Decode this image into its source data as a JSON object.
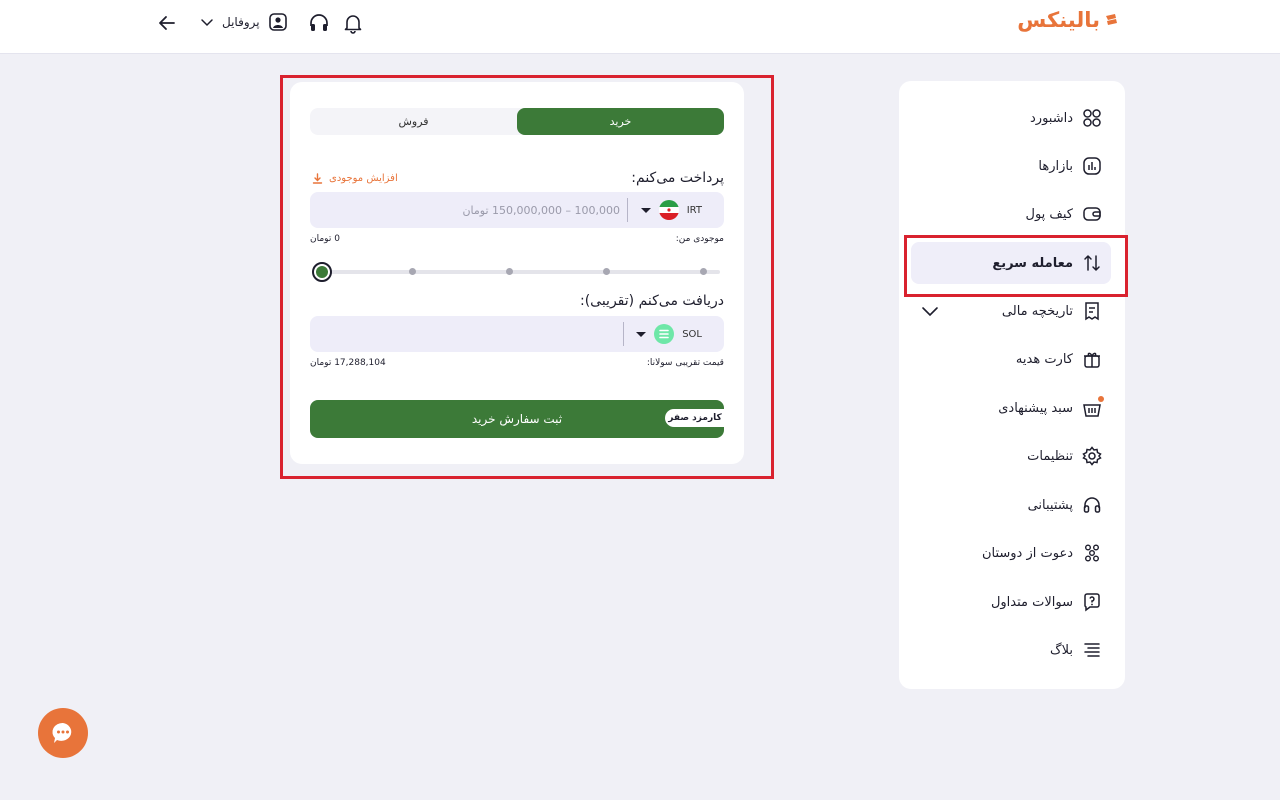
{
  "header": {
    "logo_text": "بالینکس",
    "profile_label": "پروفایل"
  },
  "sidebar": {
    "items": [
      {
        "label": "داشبورد",
        "icon": "grid-icon"
      },
      {
        "label": "بازارها",
        "icon": "markets-icon"
      },
      {
        "label": "کیف پول",
        "icon": "wallet-icon"
      },
      {
        "label": "معامله سریع",
        "icon": "swap-icon",
        "active": true
      },
      {
        "label": "تاریخچه مالی",
        "icon": "receipt-icon",
        "expandable": true
      },
      {
        "label": "کارت هدیه",
        "icon": "gift-icon"
      },
      {
        "label": "سبد پیشنهادی",
        "icon": "basket-icon",
        "badge": true
      },
      {
        "label": "تنظیمات",
        "icon": "gear-icon"
      },
      {
        "label": "پشتیبانی",
        "icon": "headset-icon"
      },
      {
        "label": "دعوت از دوستان",
        "icon": "invite-icon"
      },
      {
        "label": "سوالات متداول",
        "icon": "question-icon"
      },
      {
        "label": "بلاگ",
        "icon": "blog-icon"
      }
    ]
  },
  "trade": {
    "tabs": {
      "buy": "خرید",
      "sell": "فروش",
      "active": "buy"
    },
    "pay": {
      "title": "پرداخت می‌کنم:",
      "increase_balance": "افزایش موجودی",
      "currency": "IRT",
      "placeholder": "100,000 – 150,000,000 تومان",
      "balance_label": "موجودی من:",
      "balance_value": "0 تومان"
    },
    "slider": {
      "value_percent": 0,
      "steps": 5
    },
    "receive": {
      "title": "دریافت می‌کنم (تقریبی):",
      "currency": "SOL",
      "value": "",
      "price_label": "قیمت تقریبی سولانا:",
      "price_value": "17,288,104 تومان"
    },
    "submit_label": "ثبت سفارش خرید",
    "fee_badge": "کارمزد صفر"
  },
  "colors": {
    "accent_green": "#3c7a38",
    "brand_orange": "#e8743a",
    "highlight_red": "#d9222f"
  }
}
